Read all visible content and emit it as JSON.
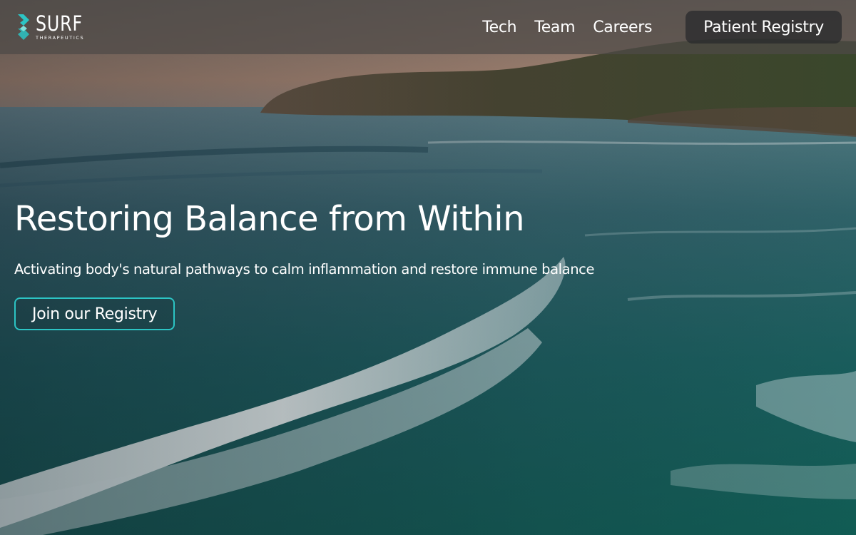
{
  "brand": {
    "name": "SURF",
    "subtitle": "THERAPEUTICS",
    "icon": "surf-logo-icon"
  },
  "nav": {
    "links": [
      {
        "label": "Tech"
      },
      {
        "label": "Team"
      },
      {
        "label": "Careers"
      }
    ],
    "cta_label": "Patient Registry"
  },
  "hero": {
    "title": "Restoring Balance from Within",
    "subtitle": "Activating body's natural pathways to calm inflammation and restore immune balance",
    "button_label": "Join our Registry",
    "background": "ocean-coastline-aerial-image"
  },
  "colors": {
    "accent": "#2cc4c4",
    "nav_background": "#4e4a46",
    "button_dark": "#282a2c"
  }
}
